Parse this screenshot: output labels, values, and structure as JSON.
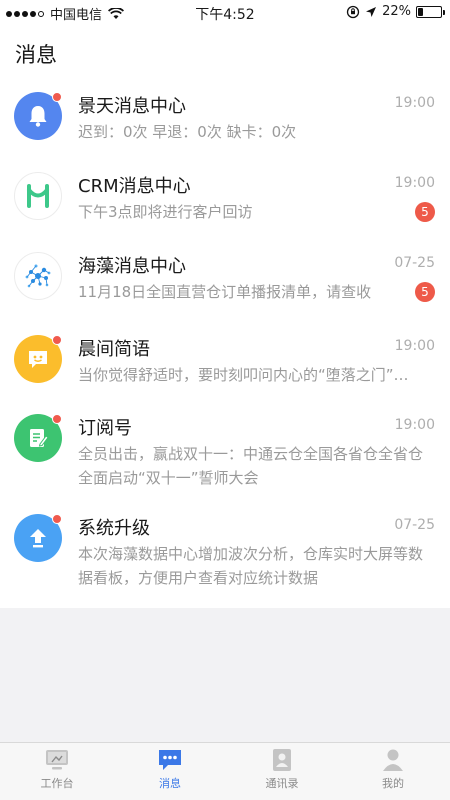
{
  "status_bar": {
    "carrier": "中国电信",
    "time": "下午4:52",
    "battery": "22%",
    "battery_level": 0.22
  },
  "header": {
    "title": "消息"
  },
  "messages": [
    {
      "title": "景天消息中心",
      "time": "19:00",
      "subtitle": "迟到：0次    早退：0次    缺卡：0次",
      "unread_dot": true,
      "badge": "",
      "icon": "bell-icon",
      "color": "#5486ef"
    },
    {
      "title": "CRM消息中心",
      "time": "19:00",
      "subtitle": "下午3点即将进行客户回访",
      "unread_dot": false,
      "badge": "5",
      "icon": "crm-logo-icon",
      "color": "#ffffff"
    },
    {
      "title": "海藻消息中心",
      "time": "07-25",
      "subtitle": "11月18日全国直营仓订单播报清单，请查收",
      "unread_dot": false,
      "badge": "5",
      "icon": "network-logo-icon",
      "color": "#ffffff"
    },
    {
      "title": "晨间简语",
      "time": "19:00",
      "subtitle": "当你觉得舒适时，要时刻叩问内心的“堕落之门”…",
      "unread_dot": true,
      "badge": "",
      "icon": "chat-bubble-icon",
      "color": "#fbbd2c"
    },
    {
      "title": "订阅号",
      "time": "19:00",
      "subtitle": "全员出击，赢战双十一：中通云仓全国各省仓全省仓全面启动“双十一”誓师大会",
      "unread_dot": true,
      "badge": "",
      "icon": "document-edit-icon",
      "color": "#3dc471"
    },
    {
      "title": "系统升级",
      "time": "07-25",
      "subtitle": "本次海藻数据中心增加波次分析，仓库实时大屏等数据看板，方便用户查看对应统计数据",
      "unread_dot": true,
      "badge": "",
      "icon": "upgrade-arrow-icon",
      "color": "#4aa2f4"
    }
  ],
  "tabbar": {
    "items": [
      {
        "label": "工作台",
        "icon": "monitor-icon",
        "active": false
      },
      {
        "label": "消息",
        "icon": "message-icon",
        "active": true
      },
      {
        "label": "通讯录",
        "icon": "contacts-icon",
        "active": false
      },
      {
        "label": "我的",
        "icon": "profile-icon",
        "active": false
      }
    ]
  },
  "colors": {
    "accent": "#3b78e7",
    "badge": "#ee5a49"
  }
}
